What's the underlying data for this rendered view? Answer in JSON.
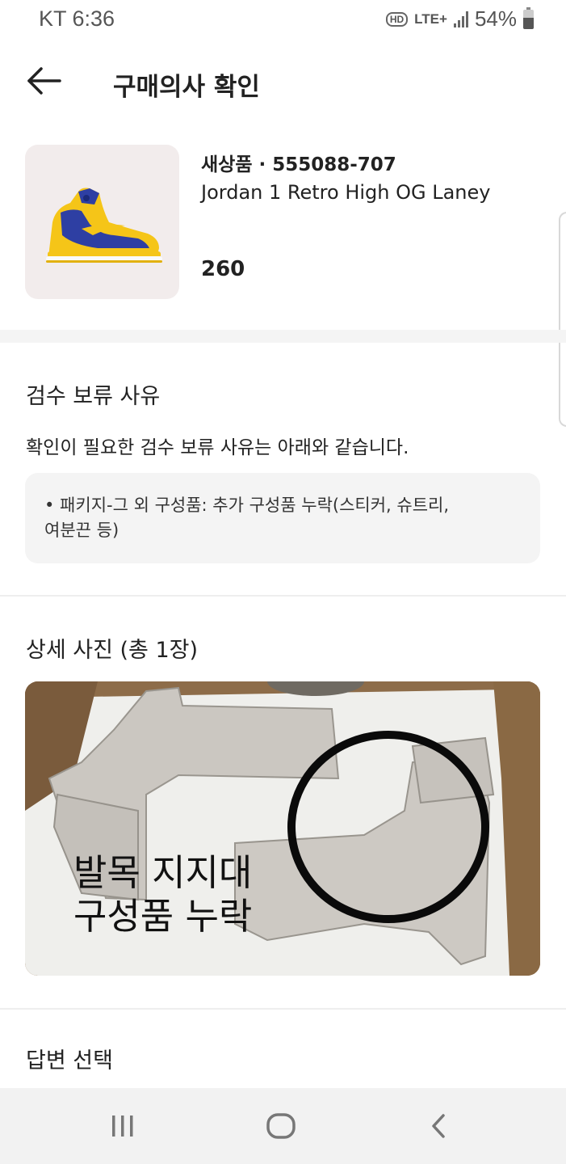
{
  "status_bar": {
    "carrier_time": "KT 6:36",
    "hd": "HD",
    "network": "LTE+",
    "battery": "54%"
  },
  "header": {
    "title": "구매의사 확인"
  },
  "product": {
    "meta": "새상품 · 555088-707",
    "name": "Jordan 1 Retro High OG Laney",
    "size": "260"
  },
  "inspection": {
    "title": "검수 보류 사유",
    "description": "확인이 필요한 검수 보류 사유는 아래와 같습니다.",
    "reason_line1": "• 패키지-그 외 구성품: 추가 구성품 누락(스티커, 슈트리,",
    "reason_line2": "여분끈 등)"
  },
  "photos": {
    "title": "상세 사진 (총 1장)",
    "caption_line1": "발목 지지대",
    "caption_line2": "구성품 누락"
  },
  "answer": {
    "title": "답변 선택"
  },
  "colors": {
    "accent": "#222222",
    "box_bg": "#f4f4f4",
    "shoe_yellow": "#f5c518",
    "shoe_blue": "#2e3fa3"
  }
}
